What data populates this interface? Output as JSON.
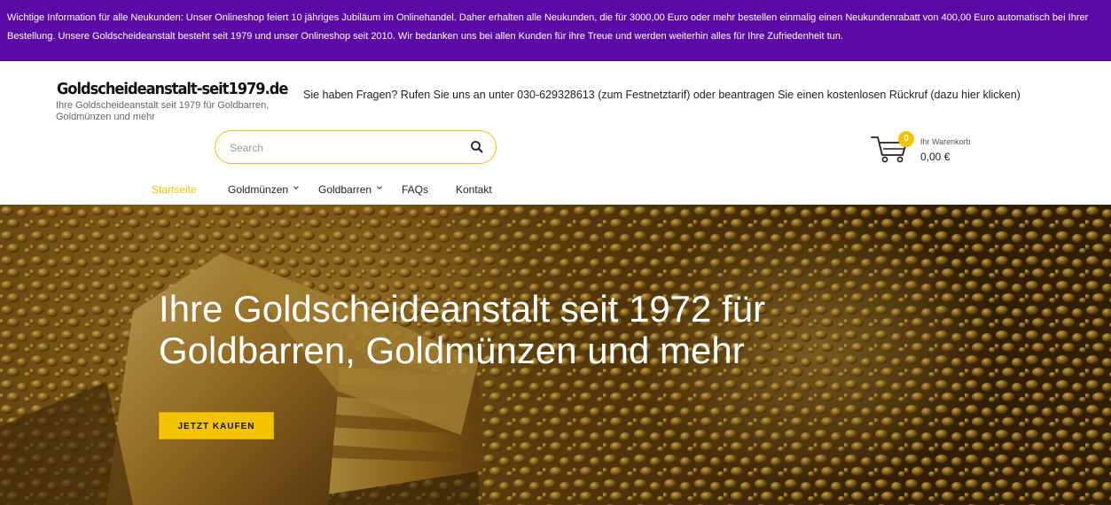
{
  "notice": {
    "text": "Wichtige Information für alle Neukunden: Unser Onlineshop feiert 10 jähriges Jubiläum im Onlinehandel. Daher erhalten alle Neukunden, die für 3000,00 Euro oder mehr bestellen einmalig einen Neukundenrabatt von 400,00 Euro automatisch bei Ihrer Bestellung. Unsere Goldscheideanstalt besteht seit 1979 und unser Onlineshop seit 2010. Wir bedanken uns bei allen Kunden für ihre Treue und werden weiterhin alles für Ihre Zufriedenheit tun."
  },
  "logo": {
    "title": "Goldscheideanstalt-seit1979.de",
    "subtitle": "Ihre Goldscheideanstalt seit 1979 für Goldbarren, Goldmünzen und mehr"
  },
  "header": {
    "question": "Sie haben Fragen? Rufen Sie uns an unter 030-629328613 (zum Festnetztarif) oder beantragen Sie einen kostenlosen Rückruf (dazu hier klicken)"
  },
  "search": {
    "placeholder": "Search",
    "value": ""
  },
  "cart": {
    "count": "0",
    "label": "Ihr Warenkorb",
    "total": "0,00 €"
  },
  "nav": {
    "items": [
      {
        "label": "Startseite",
        "active": true
      },
      {
        "label": "Goldmünzen",
        "dropdown": true
      },
      {
        "label": "Goldbarren",
        "dropdown": true
      },
      {
        "label": "FAQs"
      },
      {
        "label": "Kontakt"
      }
    ]
  },
  "hero": {
    "title": "Ihre Goldscheideanstalt seit 1972 für Goldbarren, Goldmünzen und mehr",
    "cta": "JETZT KAUFEN"
  },
  "colors": {
    "notice_bg": "#5b0aa5",
    "accent": "#f5c400",
    "nav_active": "#f2c300"
  },
  "icons": {
    "search": "magnifier-icon",
    "cart": "shopping-cart-icon",
    "dropdown": "chevron-down-icon"
  }
}
